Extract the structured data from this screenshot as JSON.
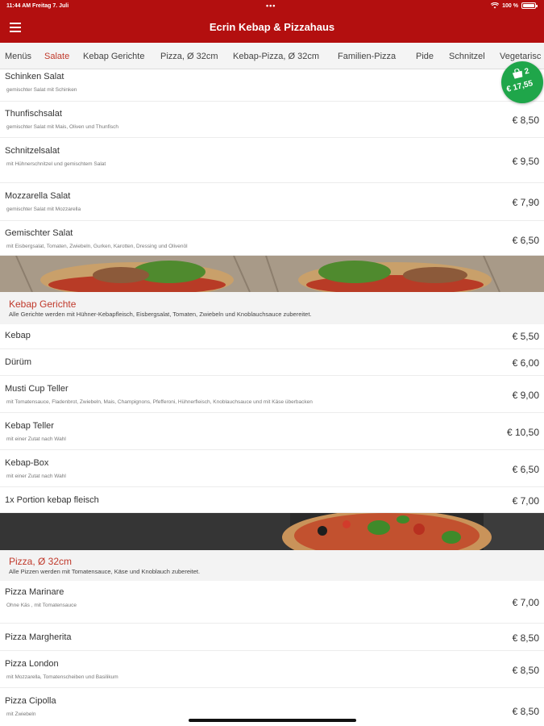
{
  "status": {
    "time": "11:44 AM",
    "date": "Freitag 7. Juli",
    "dots": "•••",
    "battery": "100 %"
  },
  "header": {
    "title": "Ecrin Kebap & Pizzahaus",
    "menu_icon": "hamburger-icon"
  },
  "tabs": [
    {
      "label": "Menüs",
      "active": false
    },
    {
      "label": "Salate",
      "active": true
    },
    {
      "label": "Kebap Gerichte",
      "active": false
    },
    {
      "label": "Pizza, Ø 32cm",
      "active": false
    },
    {
      "label": "Kebap-Pizza, Ø 32cm",
      "active": false
    },
    {
      "label": "Familien-Pizza",
      "active": false
    },
    {
      "label": "Pide",
      "active": false
    },
    {
      "label": "Schnitzel",
      "active": false
    },
    {
      "label": "Vegetarisc",
      "active": false
    }
  ],
  "cart": {
    "count": "2",
    "total": "€ 17,55",
    "icon": "shopping-bag-icon",
    "color": "#1fa64a"
  },
  "salate": [
    {
      "name": "Schinken Salat",
      "desc": "gemischter Salat mit Schinken",
      "price": ""
    },
    {
      "name": "Thunfischsalat",
      "desc": "gemischter Salat mit Mais, Oliven und Thunfisch",
      "price": "€ 8,50"
    },
    {
      "name": "Schnitzelsalat",
      "desc": "mit Hühnerschnitzel und gemischtem Salat",
      "price": "€ 9,50"
    },
    {
      "name": "Mozzarella Salat",
      "desc": "gemischter Salat mit Mozzarella",
      "price": "€ 7,90"
    },
    {
      "name": "Gemischter Salat",
      "desc": "mit Eisbergsalat, Tomaten, Zwiebeln, Gurken, Karotten, Dressing und Olivenöl",
      "price": "€ 6,50"
    }
  ],
  "kebap_section": {
    "title": "Kebap Gerichte",
    "subtitle": "Alle Gerichte werden mit Hühner-Kebapfleisch, Eisbergsalat, Tomaten, Zwiebeln und Knoblauchsauce zubereitet."
  },
  "kebap": [
    {
      "name": "Kebap",
      "desc": "",
      "price": "€ 5,50"
    },
    {
      "name": "Dürüm",
      "desc": "",
      "price": "€ 6,00"
    },
    {
      "name": "Musti Cup Teller",
      "desc": "mit Tomatensauce, Fladenbrot, Zwiebeln, Mais, Champignons, Pfefferoni, Hühnerfleisch, Knoblauchsauce und mit Käse überbacken",
      "price": "€ 9,00"
    },
    {
      "name": "Kebap Teller",
      "desc": "mit einer Zutat nach Wahl",
      "price": "€ 10,50"
    },
    {
      "name": "Kebap-Box",
      "desc": "mit einer Zutat nach Wahl",
      "price": "€ 6,50"
    },
    {
      "name": "1x Portion kebap fleisch",
      "desc": "",
      "price": "€ 7,00"
    }
  ],
  "pizza_section": {
    "title": "Pizza, Ø 32cm",
    "subtitle": "Alle Pizzen werden mit Tomatensauce, Käse und Knoblauch zubereitet."
  },
  "pizza": [
    {
      "name": "Pizza Marinare",
      "desc": "Ohne Käs , mit Tomatensauce",
      "price": "€ 7,00"
    },
    {
      "name": "Pizza Margherita",
      "desc": "",
      "price": "€ 8,50"
    },
    {
      "name": "Pizza London",
      "desc": "mit Mozzarella, Tomatenscheiben und Basilikum",
      "price": "€ 8,50"
    },
    {
      "name": "Pizza Cipolla",
      "desc": "mit Zwiebeln",
      "price": "€ 8,50"
    }
  ],
  "colors": {
    "brand": "#b30f0f",
    "accent": "#c0392b",
    "cart": "#1fa64a"
  }
}
